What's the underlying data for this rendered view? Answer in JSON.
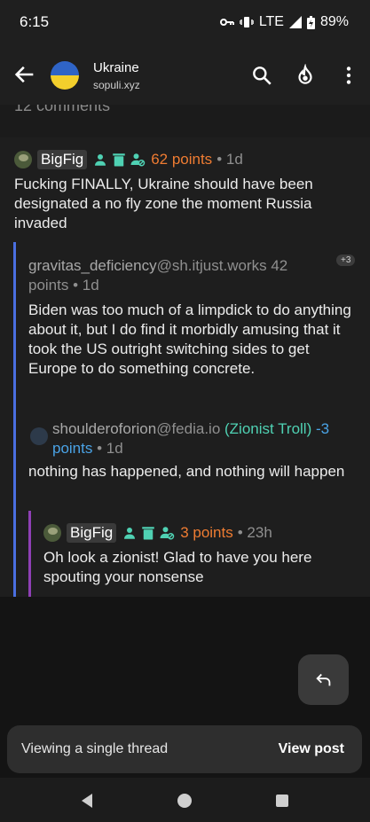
{
  "status": {
    "time": "6:15",
    "network": "LTE",
    "battery": "89%"
  },
  "header": {
    "title": "Ukraine",
    "subtitle": "sopuli.xyz",
    "comments_count": "12 comments"
  },
  "comments": [
    {
      "user": "BigFig",
      "points": "62 points",
      "age": "• 1d",
      "body": "Fucking FINALLY, Ukraine should have been designated a no fly zone the moment Russia invaded"
    },
    {
      "user": "gravitas_deficiency",
      "instance": "@sh.itjust.works",
      "points": "42",
      "points_suffix": "points",
      "age": "• 1d",
      "children_badge": "+3",
      "body": "Biden was too much of a limpdick to do anything about it, but I do find it morbidly amusing that it took the US outright switching sides to get Europe to do something concrete."
    },
    {
      "user": "shoulderoforion",
      "instance": "@fedia.io",
      "flair": "(Zionist Troll)",
      "points": "-3",
      "points_suffix": "points",
      "age": "• 1d",
      "body": "nothing has happened, and nothing will happen"
    },
    {
      "user": "BigFig",
      "points": "3 points",
      "age": "• 23h",
      "body": "Oh look a zionist! Glad to have you here spouting your nonsense"
    }
  ],
  "snackbar": {
    "text": "Viewing a single thread",
    "action": "View post"
  },
  "colors": {
    "accent_teal": "#4fd1b3",
    "points_orange": "#ef7c32",
    "thread_line_blue": "#4a6fe0",
    "thread_line_purple": "#8e3fb5"
  }
}
